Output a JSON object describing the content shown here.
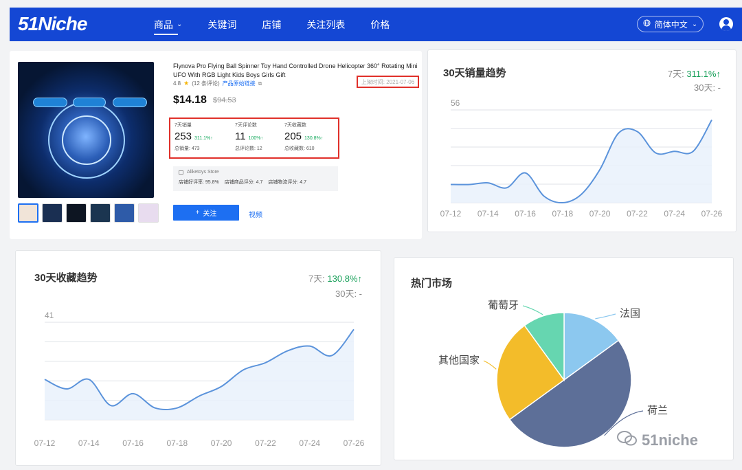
{
  "nav": {
    "logo": "51Niche",
    "items": [
      {
        "label": "商品",
        "active": true,
        "has_caret": true
      },
      {
        "label": "关键词"
      },
      {
        "label": "店铺"
      },
      {
        "label": "关注列表"
      },
      {
        "label": "价格"
      }
    ],
    "language": "简体中文"
  },
  "product": {
    "title": "Flynova Pro Flying Ball Spinner Toy Hand Controlled Drone Helicopter 360° Rotating Mini UFO With RGB Light Kids Boys Girls Gift",
    "rating": "4.8",
    "reviews_text": "(12 条评论)",
    "source_link": "产品原始链接",
    "launch_date": "上架时间: 2021-07-06",
    "price": "$14.18",
    "original_price": "$94.53",
    "stats": [
      {
        "label": "7天销量",
        "value": "253",
        "change": "311.1%↑",
        "total": "总销量: 473"
      },
      {
        "label": "7天评论数",
        "value": "11",
        "change": "100%↑",
        "total": "总评论数: 12"
      },
      {
        "label": "7天收藏数",
        "value": "205",
        "change": "130.8%↑",
        "total": "总收藏数: 610"
      }
    ],
    "store": {
      "name": "Aliketoys Store",
      "positive_rate": "店铺好评率: 95.8%",
      "product_score": "店铺商品评分: 4.7",
      "logistics_score": "店铺物流评分: 4.7"
    },
    "follow_label": "关注",
    "video_label": "视频",
    "colors": {
      "accent": "#1d6ff2",
      "up": "#13a85b",
      "highlight_border": "#e0302a"
    }
  },
  "sales_chart": {
    "title": "30天销量趋势",
    "change_7d_prefix": "7天:",
    "change_7d_value": "311.1%↑",
    "change_30d": "30天: -"
  },
  "fav_chart": {
    "title": "30天收藏趋势",
    "change_7d_prefix": "7天:",
    "change_7d_value": "130.8%↑",
    "change_30d": "30天: -"
  },
  "market": {
    "title": "热门市场"
  },
  "watermark": "51niche",
  "chart_data": [
    {
      "type": "line",
      "title": "30天销量趋势",
      "x": [
        "07-12",
        "07-13",
        "07-14",
        "07-15",
        "07-16",
        "07-17",
        "07-18",
        "07-19",
        "07-20",
        "07-21",
        "07-22",
        "07-23",
        "07-24",
        "07-25",
        "07-26"
      ],
      "xticks": [
        "07-12",
        "07-14",
        "07-16",
        "07-18",
        "07-20",
        "07-22",
        "07-24",
        "07-26"
      ],
      "values": [
        11,
        11,
        12,
        9,
        18,
        4,
        0,
        5,
        20,
        42,
        43,
        30,
        31,
        31,
        50
      ],
      "ylim": [
        0,
        56
      ],
      "ytick_label": "56",
      "color": "#5b93db"
    },
    {
      "type": "line",
      "title": "30天收藏趋势",
      "x": [
        "07-12",
        "07-13",
        "07-14",
        "07-15",
        "07-16",
        "07-17",
        "07-18",
        "07-19",
        "07-20",
        "07-21",
        "07-22",
        "07-23",
        "07-24",
        "07-25",
        "07-26"
      ],
      "xticks": [
        "07-12",
        "07-14",
        "07-16",
        "07-18",
        "07-20",
        "07-22",
        "07-24",
        "07-26"
      ],
      "values": [
        17,
        13,
        17,
        6,
        11,
        5,
        5,
        10,
        14,
        21,
        24,
        29,
        31,
        27,
        38
      ],
      "ylim": [
        0,
        41
      ],
      "ytick_label": "41",
      "color": "#5b93db"
    },
    {
      "type": "pie",
      "title": "热门市场",
      "slices": [
        {
          "label": "法国",
          "value": 15,
          "color": "#8cc8ef"
        },
        {
          "label": "荷兰",
          "value": 50,
          "color": "#5d6f98"
        },
        {
          "label": "其他国家",
          "value": 25,
          "color": "#f3bc2a"
        },
        {
          "label": "葡萄牙",
          "value": 10,
          "color": "#66d6b0"
        }
      ]
    }
  ]
}
